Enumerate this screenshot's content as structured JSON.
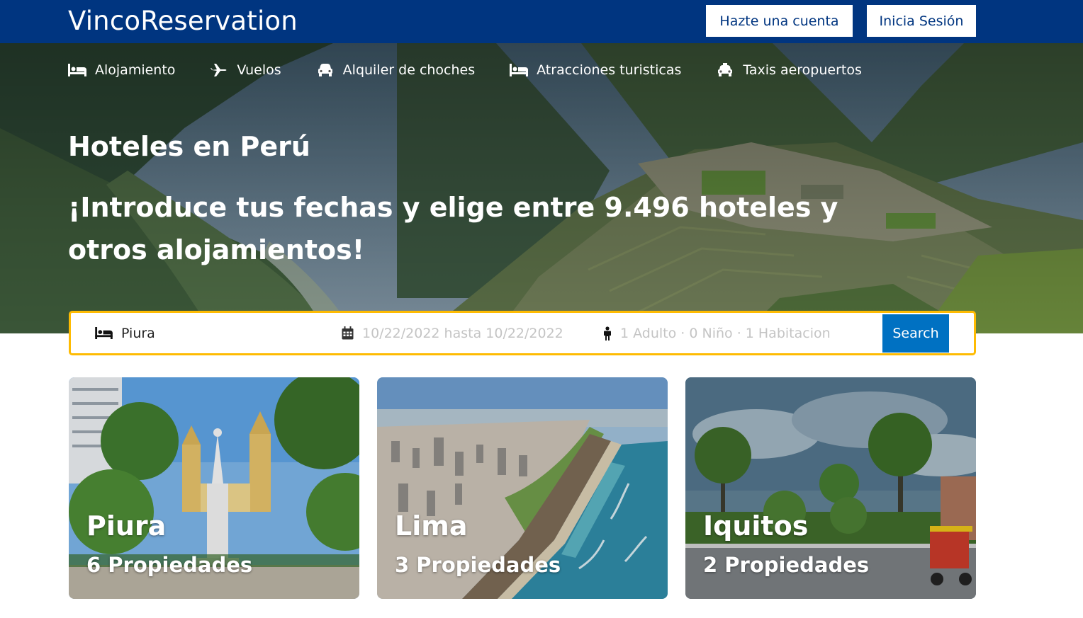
{
  "header": {
    "brand": "VincoReservation",
    "signup_label": "Hazte una cuenta",
    "login_label": "Inicia Sesión",
    "background_color": "#003580"
  },
  "nav": {
    "items": [
      {
        "label": "Alojamiento",
        "icon": "bed-icon"
      },
      {
        "label": "Vuelos",
        "icon": "plane-icon"
      },
      {
        "label": "Alquiler de choches",
        "icon": "car-icon"
      },
      {
        "label": "Atracciones turisticas",
        "icon": "bed-icon"
      },
      {
        "label": "Taxis aeropuertos",
        "icon": "taxi-icon"
      }
    ]
  },
  "hero": {
    "title": "Hoteles en Perú",
    "subtitle": "¡Introduce tus fechas y elige entre 9.496 hoteles y otros alojamientos!"
  },
  "search": {
    "destination_value": "Piura",
    "dates_placeholder": "10/22/2022 hasta 10/22/2022",
    "guests_placeholder": "1 Adulto · 0 Niño · 1 Habitacion",
    "button_label": "Search",
    "border_color": "#febb02",
    "button_color": "#0071c2"
  },
  "cards": [
    {
      "city": "Piura",
      "count": "6 Propiedades"
    },
    {
      "city": "Lima",
      "count": "3 Propiedades"
    },
    {
      "city": "Iquitos",
      "count": "2 Propiedades"
    }
  ]
}
